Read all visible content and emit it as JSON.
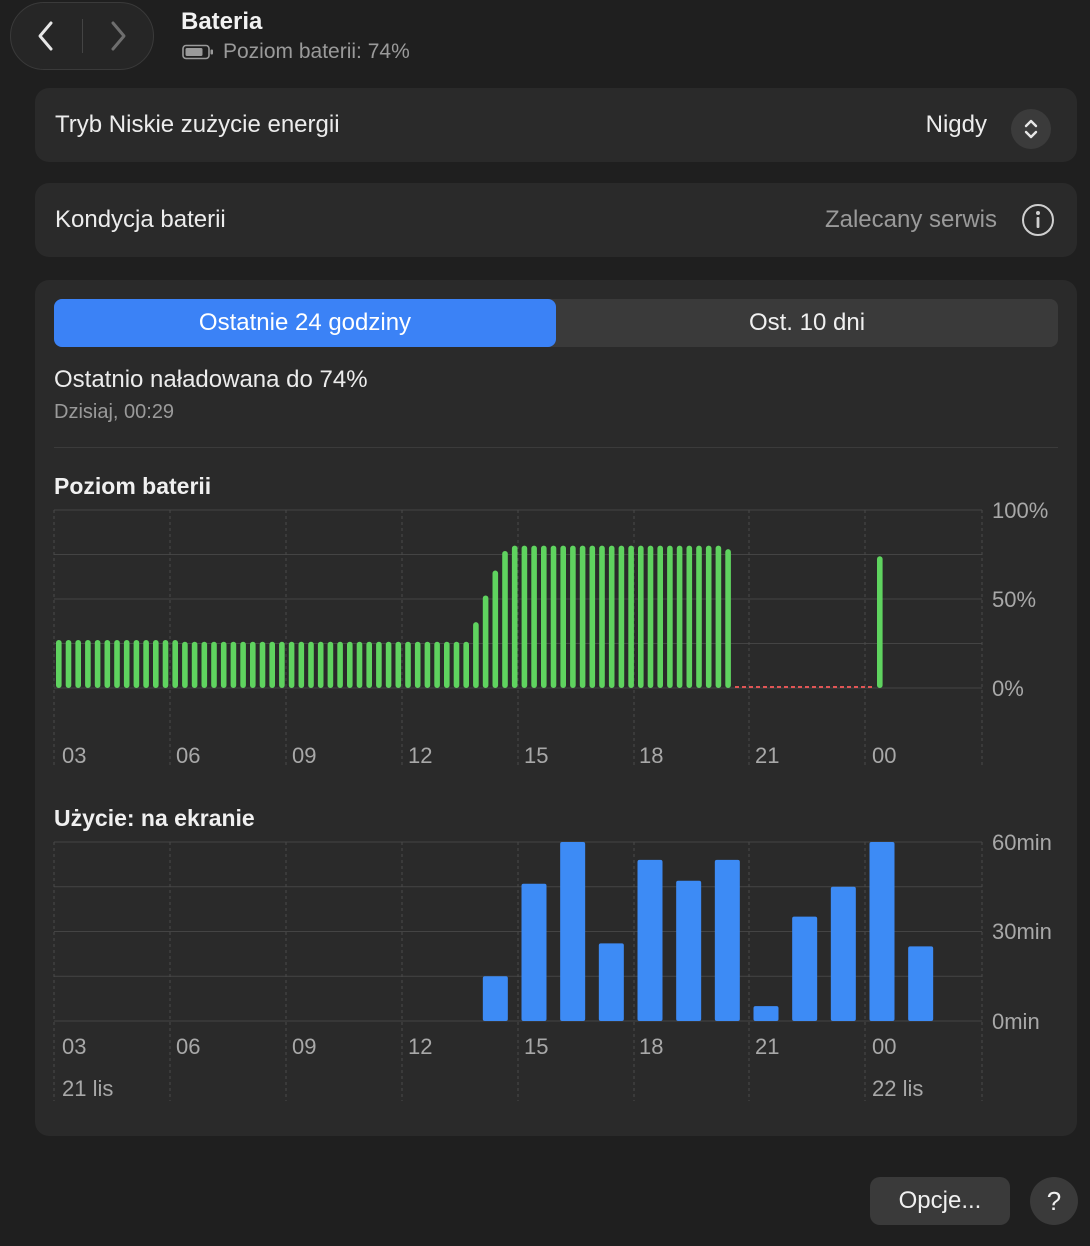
{
  "header": {
    "title": "Bateria",
    "subtitle": "Poziom baterii: 74%",
    "back_icon": "chevron-left-icon",
    "forward_icon": "chevron-right-icon"
  },
  "low_power": {
    "label": "Tryb Niskie zużycie energii",
    "value": "Nigdy"
  },
  "health": {
    "label": "Kondycja baterii",
    "value": "Zalecany serwis"
  },
  "tabs": {
    "active": "Ostatnie 24 godziny",
    "inactive": "Ost. 10 dni"
  },
  "last_charged": {
    "text": "Ostatnio naładowana do 74%",
    "date": "Dzisiaj, 00:29"
  },
  "battery_chart": {
    "title": "Poziom baterii"
  },
  "usage_chart": {
    "title": "Użycie: na ekranie"
  },
  "footer": {
    "options_label": "Opcje...",
    "help_label": "?"
  },
  "colors": {
    "accent": "#3b82f6",
    "battery_bar": "#5fd35f",
    "usage_bar": "#3d8bf5",
    "no_data_line": "#e05555"
  },
  "chart_data": [
    {
      "type": "bar",
      "title": "Poziom baterii",
      "x_ticks": [
        "03",
        "06",
        "09",
        "12",
        "15",
        "18",
        "21",
        "00"
      ],
      "y_ticks": [
        "0%",
        "50%",
        "100%"
      ],
      "ylim": [
        0,
        100
      ],
      "grid": true,
      "unit": "%",
      "values": [
        27,
        27,
        27,
        27,
        27,
        27,
        27,
        27,
        27,
        27,
        27,
        27,
        27,
        26,
        26,
        26,
        26,
        26,
        26,
        26,
        26,
        26,
        26,
        26,
        26,
        26,
        26,
        26,
        26,
        26,
        26,
        26,
        26,
        26,
        26,
        26,
        26,
        26,
        26,
        26,
        26,
        26,
        26,
        37,
        52,
        66,
        77,
        80,
        80,
        80,
        80,
        80,
        80,
        80,
        80,
        80,
        80,
        80,
        80,
        80,
        80,
        80,
        80,
        80,
        80,
        80,
        80,
        80,
        80,
        78
      ],
      "no_data_range": "20:00–00:00",
      "last_value": 74
    },
    {
      "type": "bar",
      "title": "Użycie: na ekranie",
      "x_ticks": [
        "03",
        "06",
        "09",
        "12",
        "15",
        "18",
        "21",
        "00"
      ],
      "date_labels": [
        "21 lis",
        "22 lis"
      ],
      "y_ticks": [
        "0min",
        "30min",
        "60min"
      ],
      "ylim": [
        0,
        60
      ],
      "grid": true,
      "unit": "min",
      "hours": [
        13,
        14,
        15,
        16,
        17,
        18,
        19,
        20,
        21,
        22,
        23,
        0
      ],
      "values": [
        15,
        46,
        60,
        26,
        54,
        47,
        54,
        5,
        35,
        45,
        60,
        25
      ]
    }
  ]
}
